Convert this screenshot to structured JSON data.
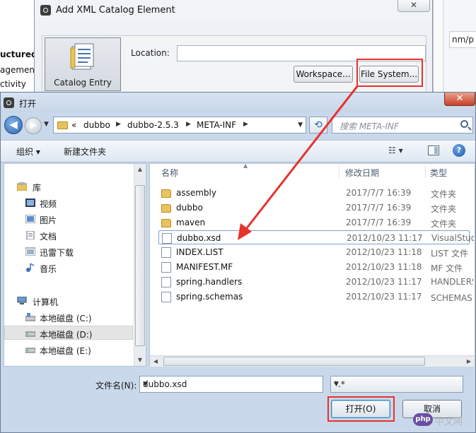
{
  "background": {
    "fragments": [
      "uctured",
      "agement",
      "ctivity"
    ],
    "right_fragment": "nm/p"
  },
  "xml_dialog": {
    "title": "Add XML Catalog Element",
    "close_symbol": "✕",
    "catalog_entry_label": "Catalog Entry",
    "location_label": "Location:",
    "location_value": "",
    "workspace_button": "Workspace...",
    "file_system_button": "File System..."
  },
  "open_dialog": {
    "title": "打开",
    "close_symbol": "✕",
    "back_symbol": "◀",
    "forward_symbol": "▶",
    "breadcrumbs": {
      "overflow": "«",
      "items": [
        "dubbo",
        "dubbo-2.5.3",
        "META-INF"
      ]
    },
    "search_placeholder": "搜索 META-INF",
    "toolbar": {
      "organize": "组织 ▾",
      "new_folder": "新建文件夹",
      "view": "☷ ▾",
      "help": "?"
    },
    "nav": {
      "library": "库",
      "items": [
        "视频",
        "图片",
        "文档",
        "迅雷下载",
        "音乐"
      ],
      "computer": "计算机",
      "drives": [
        "本地磁盘 (C:)",
        "本地磁盘 (D:)",
        "本地磁盘 (E:)"
      ],
      "selected_drive": "本地磁盘 (D:)"
    },
    "columns": {
      "name": "名称",
      "modified": "修改日期",
      "type": "类型"
    },
    "files": [
      {
        "name": "assembly",
        "date": "2017/7/7 16:39",
        "type": "文件夹",
        "kind": "folder"
      },
      {
        "name": "dubbo",
        "date": "2017/7/7 16:39",
        "type": "文件夹",
        "kind": "folder"
      },
      {
        "name": "maven",
        "date": "2017/7/7 16:39",
        "type": "文件夹",
        "kind": "folder"
      },
      {
        "name": "dubbo.xsd",
        "date": "2012/10/23 11:17",
        "type": "VisualStudio",
        "kind": "file"
      },
      {
        "name": "INDEX.LIST",
        "date": "2012/10/23 11:18",
        "type": "LIST 文件",
        "kind": "file"
      },
      {
        "name": "MANIFEST.MF",
        "date": "2012/10/23 11:18",
        "type": "MF 文件",
        "kind": "file"
      },
      {
        "name": "spring.handlers",
        "date": "2012/10/23 11:17",
        "type": "HANDLERS",
        "kind": "file"
      },
      {
        "name": "spring.schemas",
        "date": "2012/10/23 11:17",
        "type": "SCHEMAS 文",
        "kind": "file"
      }
    ],
    "selected_file": "dubbo.xsd",
    "filename_label": "文件名(N):",
    "filename_value": "dubbo.xsd",
    "filter_value": "*.*",
    "open_button": "打开(O)",
    "cancel_button": "取消"
  },
  "annotations": {
    "highlight_color": "#e8322c"
  },
  "watermark": {
    "logo": "php",
    "text": "中文网"
  }
}
